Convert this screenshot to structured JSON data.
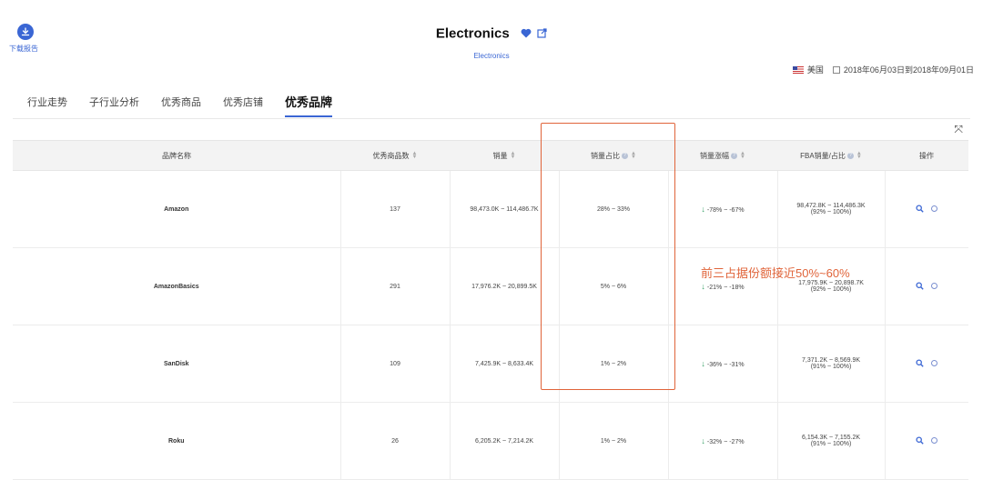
{
  "header": {
    "download_label": "下载报告",
    "title": "Electronics",
    "subtitle": "Electronics",
    "country": "美国",
    "date_range": "2018年06月03日到2018年09月01日"
  },
  "tabs": [
    {
      "label": "行业走势",
      "active": false
    },
    {
      "label": "子行业分析",
      "active": false
    },
    {
      "label": "优秀商品",
      "active": false
    },
    {
      "label": "优秀店铺",
      "active": false
    },
    {
      "label": "优秀品牌",
      "active": true
    }
  ],
  "table": {
    "columns": [
      "品牌名称",
      "优秀商品数",
      "销量",
      "销量占比",
      "销量涨幅",
      "FBA销量/占比",
      "操作"
    ],
    "rows": [
      {
        "brand": "Amazon",
        "count": "137",
        "sales": "98,473.0K ~ 114,486.7K",
        "share": "28% ~ 33%",
        "growth": "-78% ~ -67%",
        "fba_sales": "98,472.8K ~ 114,486.3K",
        "fba_share": "(92% ~ 100%)"
      },
      {
        "brand": "AmazonBasics",
        "count": "291",
        "sales": "17,976.2K ~ 20,899.5K",
        "share": "5% ~ 6%",
        "growth": "-21% ~ -18%",
        "fba_sales": "17,975.9K ~ 20,898.7K",
        "fba_share": "(92% ~ 100%)"
      },
      {
        "brand": "SanDisk",
        "count": "109",
        "sales": "7,425.9K ~ 8,633.4K",
        "share": "1% ~ 2%",
        "growth": "-36% ~ -31%",
        "fba_sales": "7,371.2K ~ 8,569.9K",
        "fba_share": "(91% ~ 100%)"
      },
      {
        "brand": "Roku",
        "count": "26",
        "sales": "6,205.2K ~ 7,214.2K",
        "share": "1% ~ 2%",
        "growth": "-32% ~ -27%",
        "fba_sales": "6,154.3K ~ 7,155.2K",
        "fba_share": "(91% ~ 100%)"
      }
    ]
  },
  "annotation": "前三占据份额接近50%~60%",
  "colors": {
    "accent": "#3a66d4",
    "highlight": "#e0643a",
    "down_arrow": "#3ba36b"
  }
}
